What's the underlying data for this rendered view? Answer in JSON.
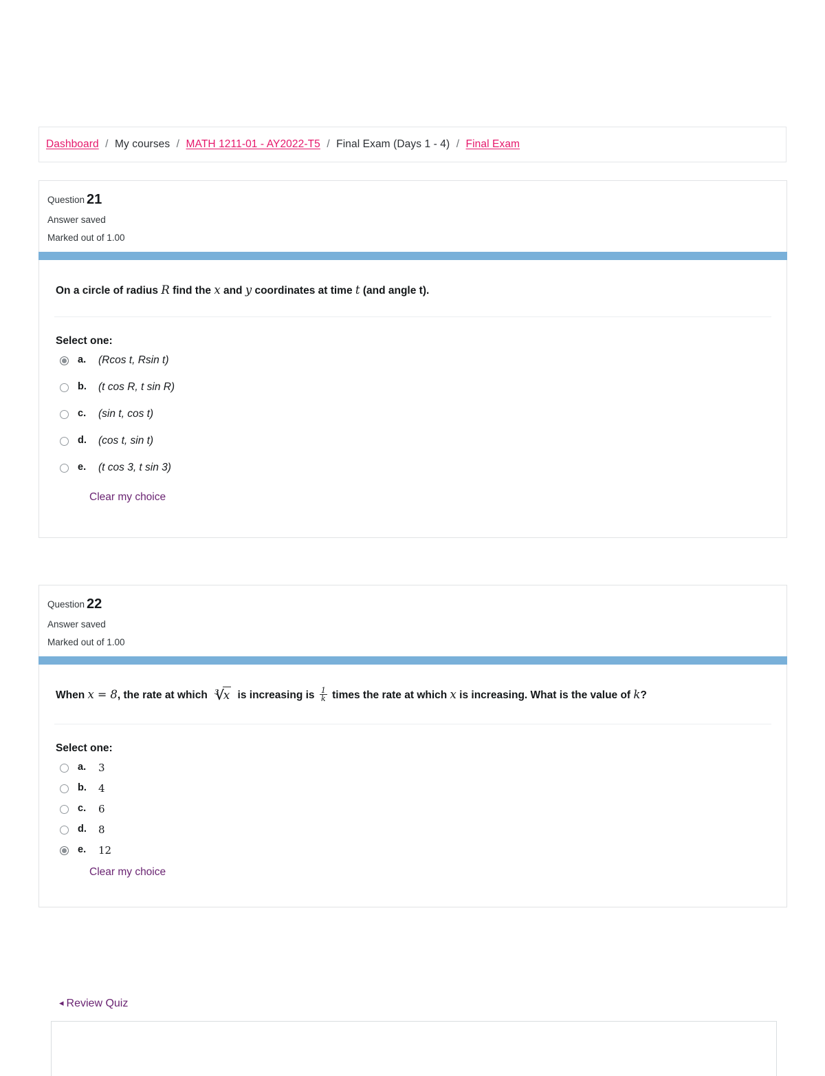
{
  "breadcrumb": {
    "items": [
      {
        "label": "Dashboard",
        "link": true
      },
      {
        "label": "My courses",
        "link": false
      },
      {
        "label": "MATH 1211-01 - AY2022-T5",
        "link": true
      },
      {
        "label": "Final Exam (Days 1 - 4)",
        "link": false
      },
      {
        "label": "Final Exam",
        "link": true
      }
    ],
    "separator": "/"
  },
  "questions": [
    {
      "number_label": "Question",
      "number": "21",
      "status": "Answer saved",
      "marked_out_of": "Marked out of 1.00",
      "text_parts": {
        "p1": "On a circle of radius ",
        "var_R": "R",
        "p2": " find the ",
        "var_x": "x",
        "p3": " and ",
        "var_y": "y",
        "p4": " coordinates at time ",
        "var_t": "t",
        "p5": " (and angle t)."
      },
      "select_one_label": "Select one:",
      "options": [
        {
          "letter": "a.",
          "text": "(Rcos t, Rsin t)",
          "checked": true
        },
        {
          "letter": "b.",
          "text": "(t cos R, t sin R)",
          "checked": false
        },
        {
          "letter": "c.",
          "text": "(sin t, cos t)",
          "checked": false
        },
        {
          "letter": "d.",
          "text": "(cos t, sin t)",
          "checked": false
        },
        {
          "letter": "e.",
          "text": "(t cos 3, t sin 3)",
          "checked": false
        }
      ],
      "clear_choice_label": "Clear my choice"
    },
    {
      "number_label": "Question",
      "number": "22",
      "status": "Answer saved",
      "marked_out_of": "Marked out of 1.00",
      "text_parts": {
        "p1": "When ",
        "eq_x": "x",
        "eq_sign": "=",
        "eq_val": "8",
        "p2": ", the rate at which ",
        "radical_index": "3",
        "radical_sign": "√",
        "radical_body": "x",
        "p3": " is increasing is ",
        "frac_num": "1",
        "frac_den": "k",
        "p4": " times the rate at which ",
        "var_x2": "x",
        "p5": " is increasing. What is the value of ",
        "var_k": "k",
        "p6": "?"
      },
      "select_one_label": "Select one:",
      "options": [
        {
          "letter": "a.",
          "text": "3",
          "checked": false
        },
        {
          "letter": "b.",
          "text": "4",
          "checked": false
        },
        {
          "letter": "c.",
          "text": "6",
          "checked": false
        },
        {
          "letter": "d.",
          "text": "8",
          "checked": false
        },
        {
          "letter": "e.",
          "text": "12",
          "checked": true
        }
      ],
      "clear_choice_label": "Clear my choice"
    }
  ],
  "footer": {
    "review_quiz_label": "Review Quiz",
    "review_quiz_arrow": "◂"
  },
  "colors": {
    "breadcrumb_link": "#e6176b",
    "question_bar": "#79b0d9",
    "link_purple": "#6a2472",
    "card_border": "#e1e3e5"
  }
}
